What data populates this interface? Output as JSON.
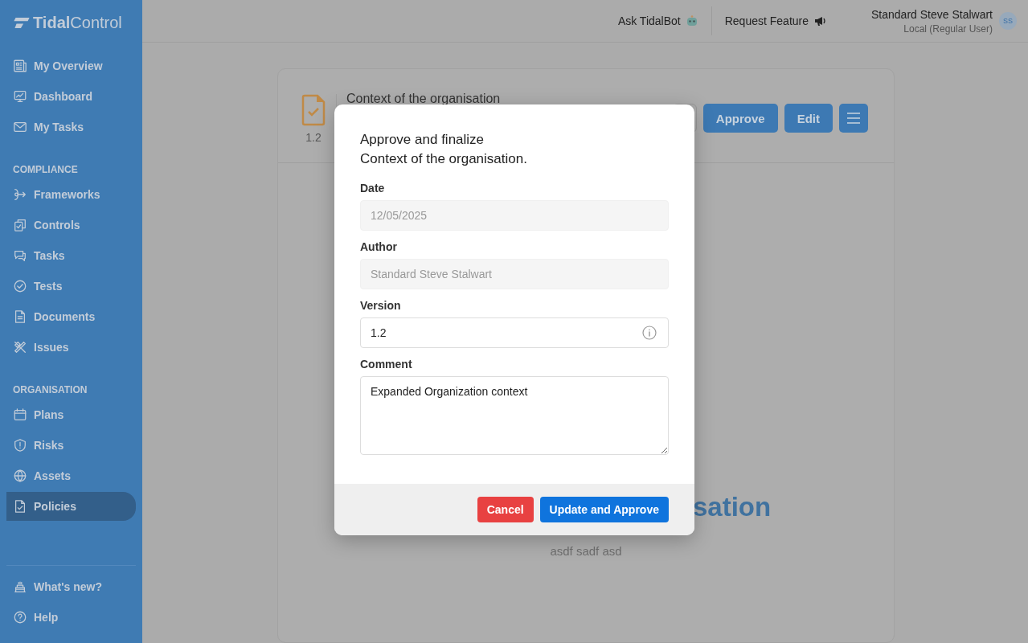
{
  "sidebar": {
    "logo": {
      "bold": "Tidal",
      "light": "Control"
    },
    "groups": [
      {
        "items": [
          {
            "label": "My Overview",
            "selected": false
          },
          {
            "label": "Dashboard",
            "selected": false
          },
          {
            "label": "My Tasks",
            "selected": false
          }
        ]
      },
      {
        "heading": "COMPLIANCE",
        "items": [
          {
            "label": "Frameworks",
            "selected": false
          },
          {
            "label": "Controls",
            "selected": false
          },
          {
            "label": "Tasks",
            "selected": false
          },
          {
            "label": "Tests",
            "selected": false
          },
          {
            "label": "Documents",
            "selected": false
          },
          {
            "label": "Issues",
            "selected": false
          }
        ]
      },
      {
        "heading": "ORGANISATION",
        "items": [
          {
            "label": "Plans",
            "selected": false
          },
          {
            "label": "Risks",
            "selected": false
          },
          {
            "label": "Assets",
            "selected": false
          },
          {
            "label": "Policies",
            "selected": true
          }
        ]
      }
    ],
    "footer": [
      {
        "label": "What's new?",
        "selected": false
      },
      {
        "label": "Help",
        "selected": false
      }
    ]
  },
  "topbar": {
    "ask": "Ask TidalBot",
    "request": "Request Feature",
    "user": {
      "name": "Standard Steve Stalwart",
      "role": "Local (Regular User)",
      "initials": "SS"
    }
  },
  "policy": {
    "version": "1.2",
    "title": "Context of the organisation",
    "actions": [
      "Approve",
      "Edit"
    ],
    "heading_visible": "sation",
    "body": "asdf sadf asd"
  },
  "modal": {
    "title": [
      "Approve and finalize",
      "Context of the organisation."
    ],
    "fields": [
      {
        "label": "Date",
        "kind": "input",
        "value": "12/05/2025",
        "disabled": true
      },
      {
        "label": "Author",
        "kind": "input",
        "value": "Standard Steve Stalwart",
        "disabled": true
      },
      {
        "label": "Version",
        "kind": "input",
        "value": "1.2",
        "disabled": false,
        "info": true
      },
      {
        "label": "Comment",
        "kind": "textarea",
        "value": "Expanded Organization context",
        "disabled": false
      }
    ],
    "buttons": [
      {
        "label": "Cancel",
        "kind": "danger"
      },
      {
        "label": "Update and Approve",
        "kind": "primary"
      }
    ]
  }
}
